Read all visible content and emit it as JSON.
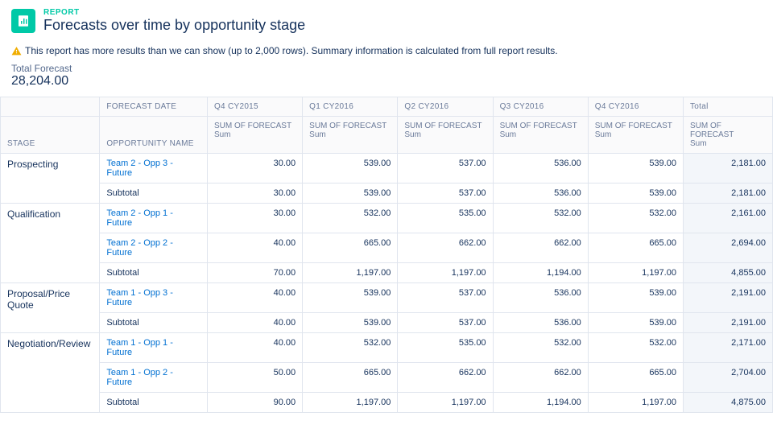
{
  "header": {
    "eyebrow": "REPORT",
    "title": "Forecasts over time by opportunity stage"
  },
  "notice": "This report has more results than we can show (up to 2,000 rows). Summary information is calculated from full report results.",
  "totals": {
    "label": "Total Forecast",
    "value": "28,204.00"
  },
  "columns": {
    "forecast_date_label": "FORECAST DATE",
    "stage_label": "STAGE",
    "opp_name_label": "OPPORTUNITY NAME",
    "sum_label": "SUM OF FORECAST",
    "sum_sub": "Sum",
    "periods": [
      "Q4 CY2015",
      "Q1 CY2016",
      "Q2 CY2016",
      "Q3 CY2016",
      "Q4 CY2016"
    ],
    "total_label": "Total"
  },
  "subtotal_label": "Subtotal",
  "groups": [
    {
      "stage": "Prospecting",
      "rows": [
        {
          "name": "Team 2 - Opp 3 - Future",
          "vals": [
            "30.00",
            "539.00",
            "537.00",
            "536.00",
            "539.00"
          ],
          "total": "2,181.00"
        }
      ],
      "subtotal": {
        "vals": [
          "30.00",
          "539.00",
          "537.00",
          "536.00",
          "539.00"
        ],
        "total": "2,181.00"
      }
    },
    {
      "stage": "Qualification",
      "rows": [
        {
          "name": "Team 2 - Opp 1 - Future",
          "vals": [
            "30.00",
            "532.00",
            "535.00",
            "532.00",
            "532.00"
          ],
          "total": "2,161.00"
        },
        {
          "name": "Team 2 - Opp 2 - Future",
          "vals": [
            "40.00",
            "665.00",
            "662.00",
            "662.00",
            "665.00"
          ],
          "total": "2,694.00"
        }
      ],
      "subtotal": {
        "vals": [
          "70.00",
          "1,197.00",
          "1,197.00",
          "1,194.00",
          "1,197.00"
        ],
        "total": "4,855.00"
      }
    },
    {
      "stage": "Proposal/Price Quote",
      "rows": [
        {
          "name": "Team 1 - Opp 3 - Future",
          "vals": [
            "40.00",
            "539.00",
            "537.00",
            "536.00",
            "539.00"
          ],
          "total": "2,191.00"
        }
      ],
      "subtotal": {
        "vals": [
          "40.00",
          "539.00",
          "537.00",
          "536.00",
          "539.00"
        ],
        "total": "2,191.00"
      }
    },
    {
      "stage": "Negotiation/Review",
      "rows": [
        {
          "name": "Team 1 - Opp 1 - Future",
          "vals": [
            "40.00",
            "532.00",
            "535.00",
            "532.00",
            "532.00"
          ],
          "total": "2,171.00"
        },
        {
          "name": "Team 1 - Opp 2 - Future",
          "vals": [
            "50.00",
            "665.00",
            "662.00",
            "662.00",
            "665.00"
          ],
          "total": "2,704.00"
        }
      ],
      "subtotal": {
        "vals": [
          "90.00",
          "1,197.00",
          "1,197.00",
          "1,194.00",
          "1,197.00"
        ],
        "total": "4,875.00"
      }
    }
  ]
}
